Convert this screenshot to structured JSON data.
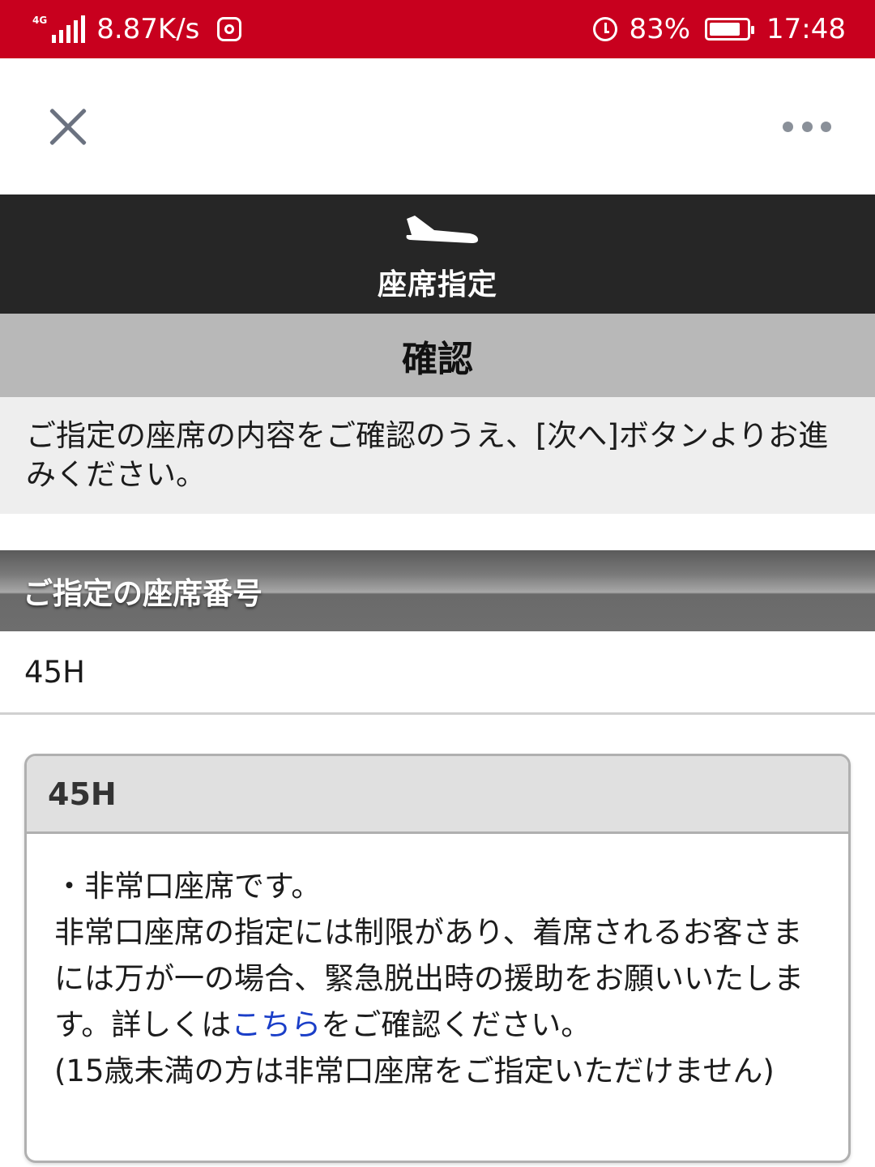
{
  "status_bar": {
    "network": "4G",
    "speed": "8.87K/s",
    "battery": "83%",
    "battery_level": 0.83,
    "time": "17:48",
    "icons": [
      "signal-icon",
      "instagram-icon",
      "alarm-icon",
      "battery-icon"
    ]
  },
  "app_bar": {
    "close_icon": "close-icon",
    "more_icon": "more-icon"
  },
  "header": {
    "icon": "airplane-icon",
    "title": "座席指定"
  },
  "confirm": {
    "title": "確認"
  },
  "instruction": {
    "text": "ご指定の座席の内容をご確認のうえ、[次へ]ボタンよりお進みください。"
  },
  "section": {
    "title": "ご指定の座席番号",
    "seat": "45H"
  },
  "card": {
    "seat": "45H",
    "bullet": "・非常口座席です。",
    "text_before_link": "非常口座席の指定には制限があり、着席されるお客さまには万が一の場合、緊急脱出時の援助をお願いいたします。詳しくは",
    "link": "こちら",
    "text_after_link": "をご確認ください。",
    "note": "(15歳未満の方は非常口座席をご指定いただけません)"
  },
  "colors": {
    "status_bar": "#c8001e",
    "dark_header": "#262626",
    "confirm_band": "#b8b8b8",
    "link": "#1a3ec8"
  }
}
